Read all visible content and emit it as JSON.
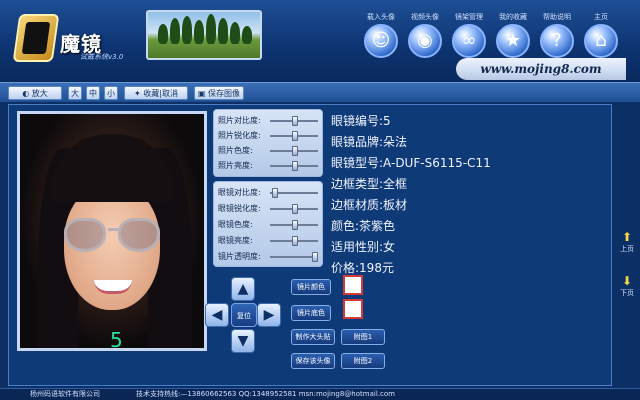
{
  "header": {
    "logo_text": "魔镜",
    "logo_sub": "试戴系统v3.0",
    "url_text": "www.mojing8.com",
    "toolbar": [
      {
        "label": "载入头像",
        "icon": "user-icon",
        "glyph": "☺"
      },
      {
        "label": "视频头像",
        "icon": "webcam-icon",
        "glyph": "◉"
      },
      {
        "label": "镜架管理",
        "icon": "glasses-icon",
        "glyph": "∞"
      },
      {
        "label": "我的收藏",
        "icon": "favorites-icon",
        "glyph": "★"
      },
      {
        "label": "帮助说明",
        "icon": "help-icon",
        "glyph": "?"
      },
      {
        "label": "主页",
        "icon": "home-icon",
        "glyph": "⌂"
      }
    ]
  },
  "topbar": {
    "buttons": [
      {
        "label": "放大",
        "icon": "zoom-icon"
      },
      {
        "label": "大"
      },
      {
        "label": "中"
      },
      {
        "label": "小"
      },
      {
        "label": "收藏|取消",
        "icon": "star-icon"
      },
      {
        "label": "保存图像",
        "icon": "save-icon"
      }
    ]
  },
  "photo": {
    "frame_number": "5"
  },
  "lens_panel": {
    "sliders": [
      {
        "label": "照片对比度:",
        "value": 0.5
      },
      {
        "label": "照片锐化度:",
        "value": 0.5
      },
      {
        "label": "照片色度:",
        "value": 0.5
      },
      {
        "label": "照片亮度:",
        "value": 0.5
      }
    ]
  },
  "frame_panel": {
    "sliders": [
      {
        "label": "眼镜对比度:",
        "value": 0.1
      },
      {
        "label": "眼镜锐化度:",
        "value": 0.5
      },
      {
        "label": "眼镜色度:",
        "value": 0.5
      },
      {
        "label": "眼镜亮度:",
        "value": 0.5
      },
      {
        "label": "镜片透明度:",
        "value": 0.9
      }
    ]
  },
  "info": {
    "rows": [
      "眼镜编号:5",
      "眼镜品牌:朵法",
      "眼镜型号:A-DUF-S6115-C11",
      "边框类型:全框",
      "边框材质:板材",
      "颜色:茶紫色",
      "适用性别:女",
      "价格:198元"
    ]
  },
  "controls": {
    "reset_label": "复位",
    "lens_color_label": "镜片颜色",
    "frame_color_label": "镜片底色",
    "make_avatar_label": "制作大头贴",
    "save_avatar_label": "保存该头像",
    "attach1_label": "附图1",
    "attach2_label": "附图2",
    "swatch_border": "#d13a3a"
  },
  "side_nav": {
    "up_label": "上页",
    "down_label": "下页"
  },
  "footer": {
    "company": "杨州码语软件有限公司",
    "support": "技术支持热线:—13860662563 QQ:1348952581 msn:mojing8@hotmail.com"
  }
}
